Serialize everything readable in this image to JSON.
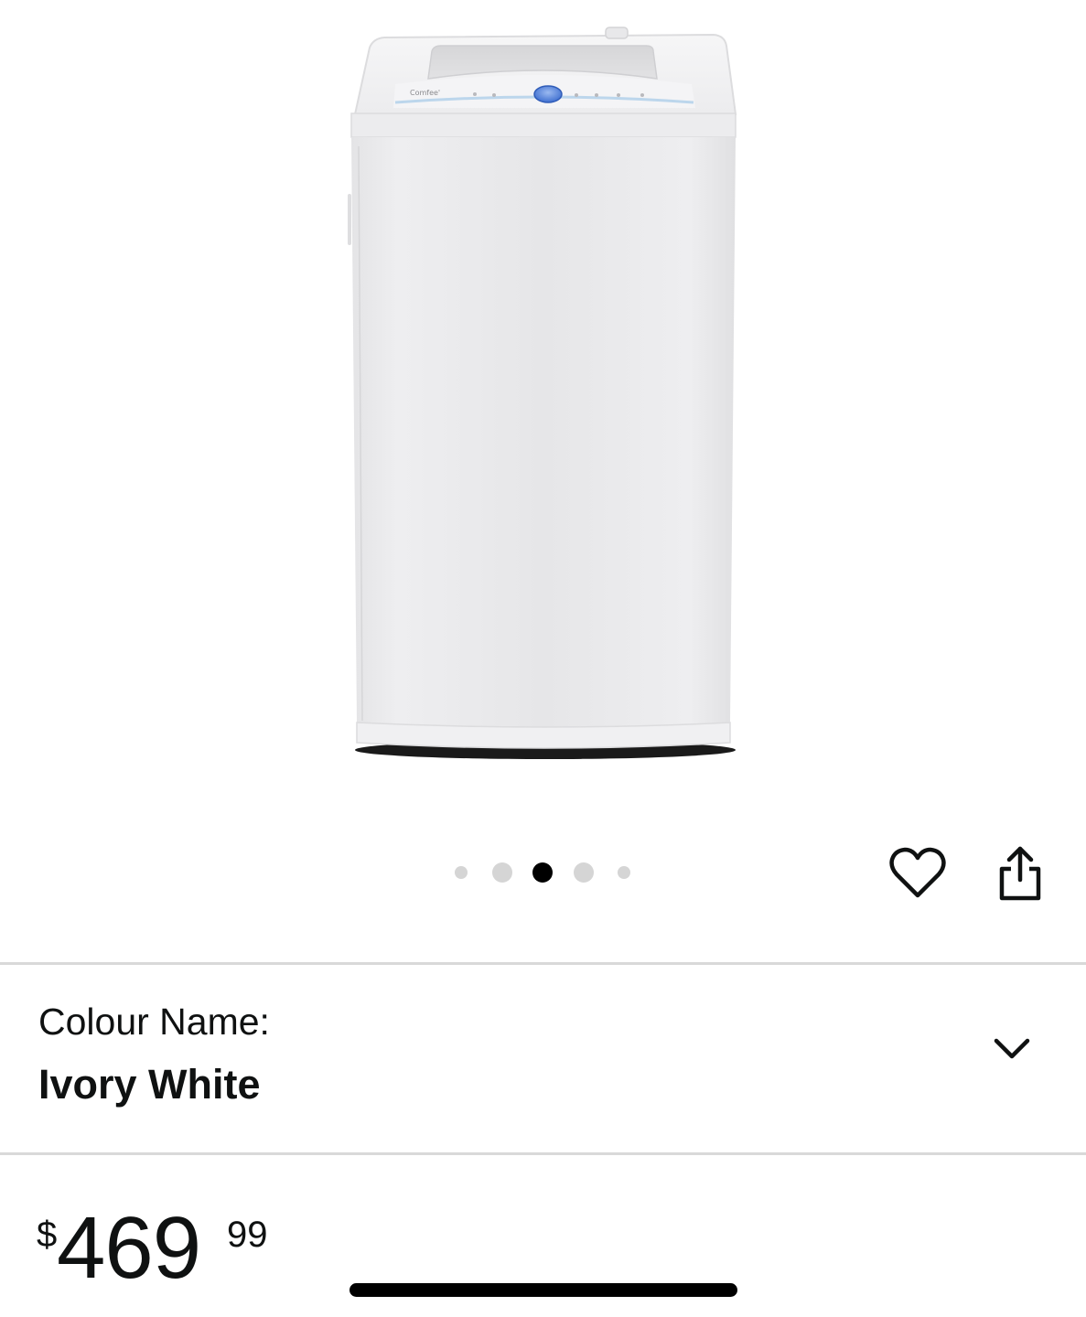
{
  "product": {
    "image_alt": "Top-load washing machine",
    "colour_label": "Colour Name:",
    "colour_value": "Ivory White"
  },
  "carousel": {
    "total": 5,
    "active_index": 2
  },
  "price": {
    "currency": "$",
    "whole": "469",
    "fraction": "99"
  },
  "icons": {
    "wishlist": "heart-icon",
    "share": "share-icon",
    "expand": "chevron-down-icon"
  },
  "colors": {
    "text": "#0f1111",
    "divider": "#d9d9d9",
    "dot_inactive": "#d5d5d5",
    "dot_active": "#000000",
    "accent_blue": "#4f7fd9"
  }
}
